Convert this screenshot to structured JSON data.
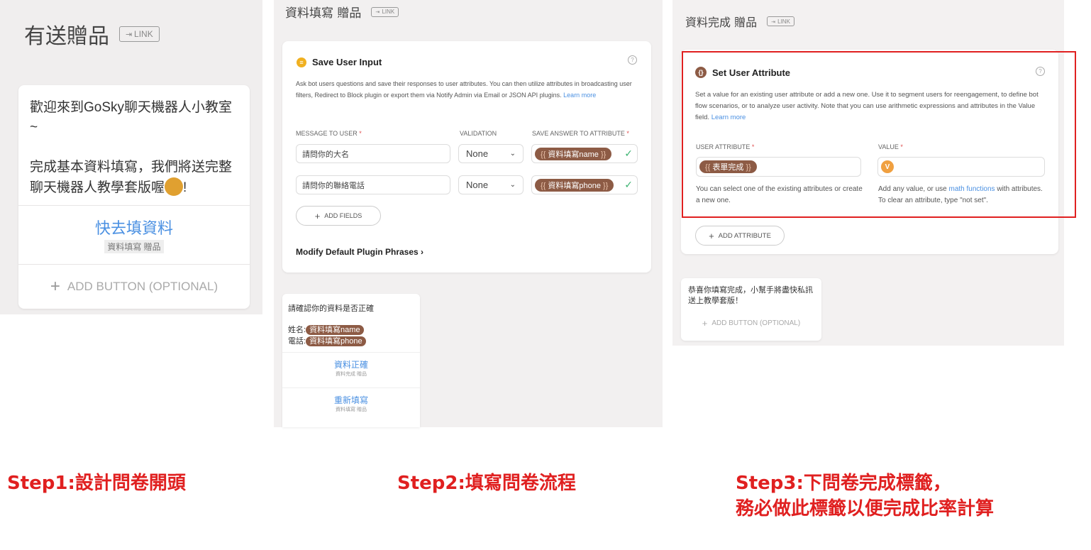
{
  "panel1": {
    "title": "有送贈品",
    "link_label": "LINK",
    "text_line1": "歡迎來到GoSky聊天機器人小教室~",
    "text_line2": "完成基本資料填寫，我們將送完整聊天機器人教學套版喔",
    "text_end": "!",
    "button_label": "快去填資料",
    "button_target": "資料填寫 贈品",
    "add_button": "ADD BUTTON (OPTIONAL)"
  },
  "panel2": {
    "title": "資料填寫 贈品",
    "link_label": "LINK",
    "plugin_title": "Save User Input",
    "plugin_desc": "Ask bot users questions and save their responses to user attributes. You can then utilize attributes in broadcasting user filters, Redirect to Block plugin or export them via Notify Admin via Email or JSON API plugins.",
    "learn_more": "Learn more",
    "col_message": "MESSAGE TO USER",
    "col_validation": "VALIDATION",
    "col_save": "SAVE ANSWER TO ATTRIBUTE",
    "rows": [
      {
        "message": "請問你的大名",
        "validation": "None",
        "attribute": "資料填寫name"
      },
      {
        "message": "請問你的聯絡電話",
        "validation": "None",
        "attribute": "資料填寫phone"
      }
    ],
    "add_fields": "ADD FIELDS",
    "modify": "Modify Default Plugin Phrases",
    "confirm_text": "請確認你的資料是否正確",
    "name_label": "姓名:",
    "name_attr": "資料填寫name",
    "phone_label": "電話:",
    "phone_attr": "資料填寫phone",
    "buttons": [
      {
        "label": "資料正確",
        "target": "資料完成 贈品"
      },
      {
        "label": "重新填寫",
        "target": "資料填寫 贈品"
      }
    ]
  },
  "panel3": {
    "title": "資料完成 贈品",
    "link_label": "LINK",
    "plugin_title": "Set User Attribute",
    "plugin_desc": "Set a value for an existing user attribute or add a new one. Use it to segment users for reengagement, to define bot flow scenarios, or to analyze user activity. Note that you can use arithmetic expressions and attributes in the Value field.",
    "learn_more": "Learn more",
    "col_attribute": "USER ATTRIBUTE",
    "col_value": "VALUE",
    "attribute": "表單完成",
    "value_chip": "V",
    "hint_attr": "You can select one of the existing attributes or create a new one.",
    "hint_value_pre": "Add any value, or use ",
    "hint_value_link": "math functions",
    "hint_value_post": " with attributes. To clear an attribute, type \"not set\".",
    "add_attribute": "ADD ATTRIBUTE",
    "done_text": "恭喜你填寫完成，小幫手將盡快私訊送上教學套版！",
    "add_button": "ADD BUTTON (OPTIONAL)"
  },
  "steps": {
    "step1": "Step1:設計問卷開頭",
    "step2": "Step2:填寫問卷流程",
    "step3_line1": "Step3:下問卷完成標籤，",
    "step3_line2": "務必做此標籤以便完成比率計算"
  },
  "colors": {
    "accent": "#4a90e2",
    "attr_chip": "#8d5b45",
    "step_red": "#e02020",
    "check": "#3cb371"
  }
}
